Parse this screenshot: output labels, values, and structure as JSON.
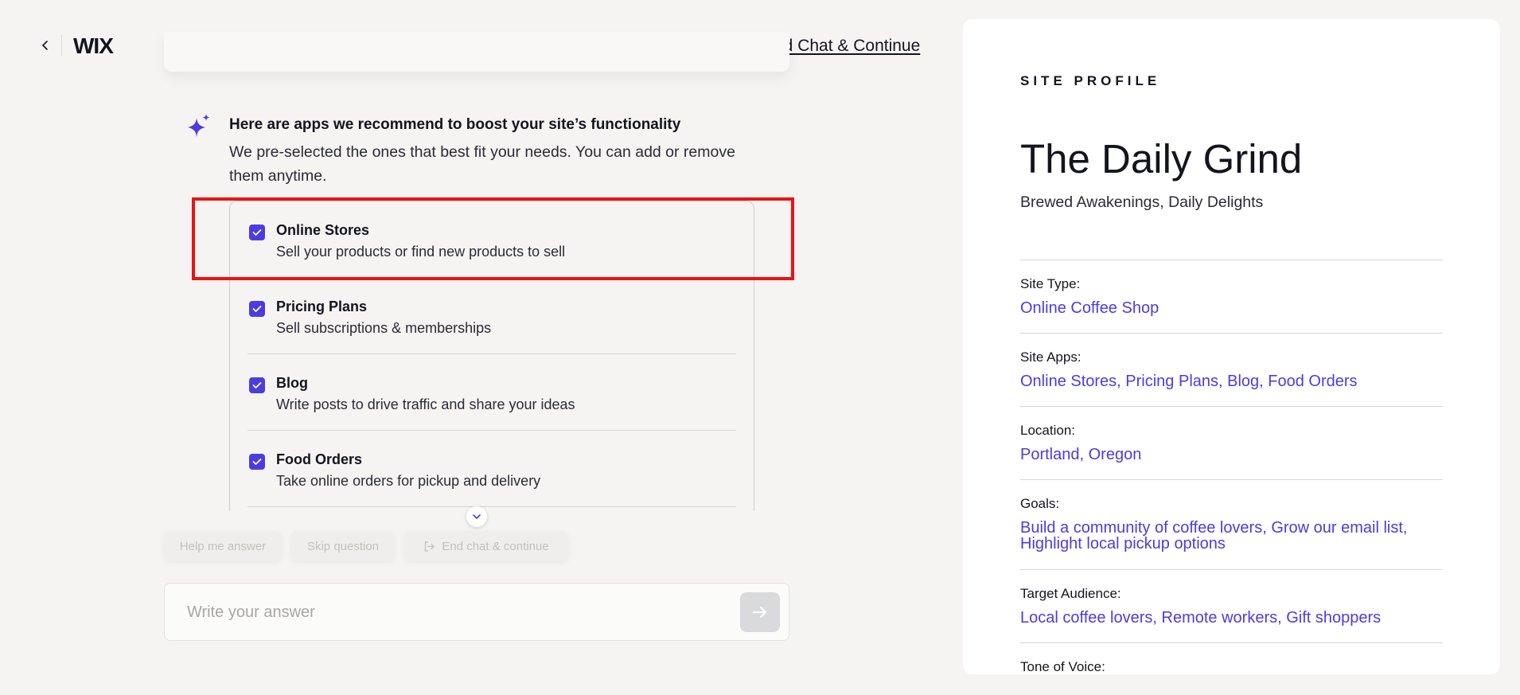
{
  "header": {
    "logo": "WIX",
    "end_chat_link": "End Chat & Continue"
  },
  "message": {
    "title": "Here are apps we recommend to boost your site’s functionality",
    "body": "We pre-selected the ones that best fit your needs. You can add or remove them anytime."
  },
  "apps": [
    {
      "name": "Online Stores",
      "description": "Sell your products or find new products to sell",
      "checked": true
    },
    {
      "name": "Pricing Plans",
      "description": "Sell subscriptions & memberships",
      "checked": true
    },
    {
      "name": "Blog",
      "description": "Write posts to drive traffic and share your ideas",
      "checked": true
    },
    {
      "name": "Food Orders",
      "description": "Take online orders for pickup and delivery",
      "checked": true
    }
  ],
  "quick_actions": {
    "help": "Help me answer",
    "skip": "Skip question",
    "end": "End chat & continue"
  },
  "answer": {
    "placeholder": "Write your answer",
    "value": ""
  },
  "profile": {
    "heading": "SITE PROFILE",
    "site_name": "The Daily Grind",
    "tagline": "Brewed Awakenings, Daily Delights",
    "fields": [
      {
        "label": "Site Type:",
        "value": "Online Coffee Shop"
      },
      {
        "label": "Site Apps:",
        "value": "Online Stores, Pricing Plans, Blog, Food Orders"
      },
      {
        "label": "Location:",
        "value": "Portland, Oregon"
      },
      {
        "label": "Goals:",
        "value": "Build a community of coffee lovers, Grow our email list, Highlight local pickup options"
      },
      {
        "label": "Target Audience:",
        "value": "Local coffee lovers, Remote workers, Gift shoppers"
      },
      {
        "label": "Tone of Voice:",
        "value": ""
      }
    ]
  },
  "colors": {
    "accent": "#4b3ce0",
    "highlight": "#ee1111",
    "background": "#f5f4f2"
  },
  "icons": {
    "back": "chevron-left-icon",
    "sparkle": "sparkle-icon",
    "checkbox": "checkmark-icon",
    "scroll": "chevron-down-icon",
    "exit": "exit-icon",
    "send": "arrow-right-icon"
  }
}
